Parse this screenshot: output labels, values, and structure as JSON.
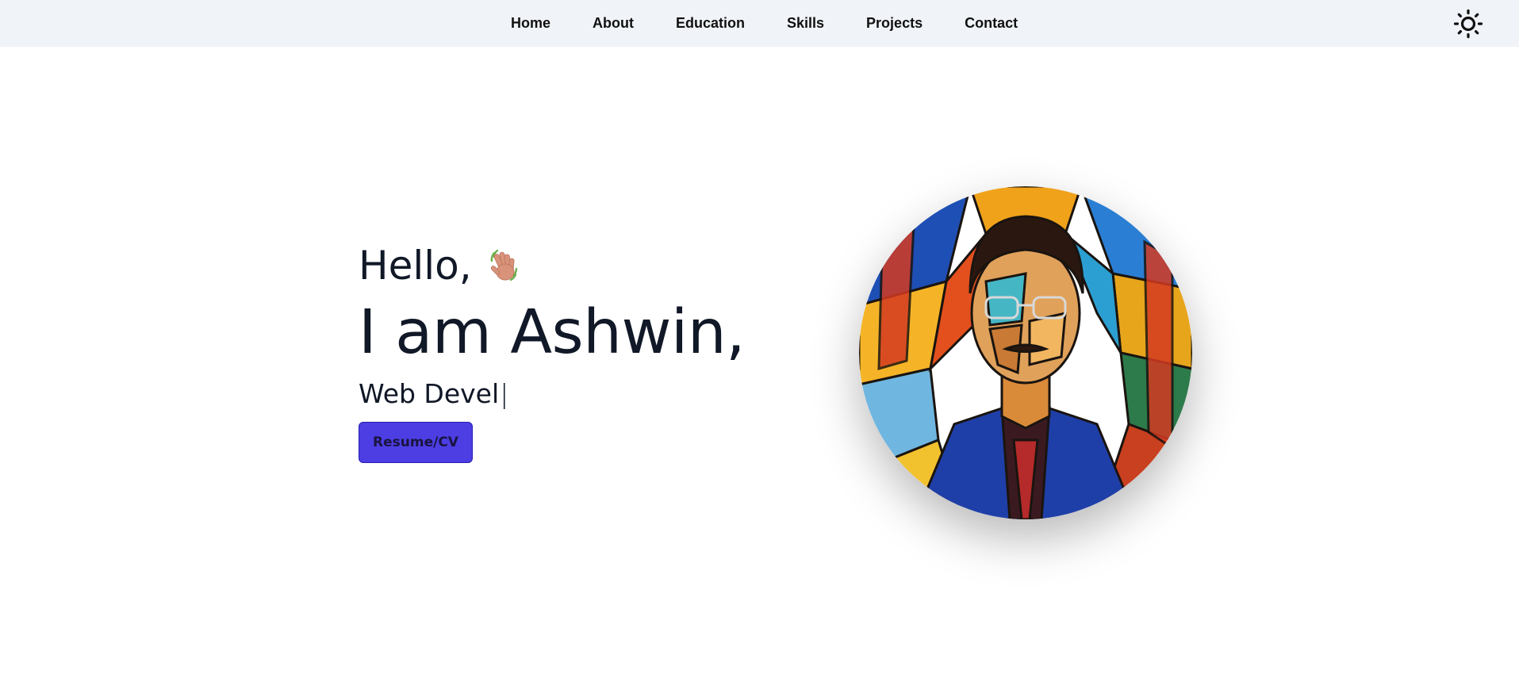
{
  "nav": {
    "links": [
      "Home",
      "About",
      "Education",
      "Skills",
      "Projects",
      "Contact"
    ],
    "theme_toggle_icon": "sun-icon"
  },
  "hero": {
    "greeting": "Hello,",
    "greeting_icon": "waving-hand-icon",
    "name_heading": "I am Ashwin,",
    "role_typed": "Web Devel",
    "caret": "|",
    "resume_button_label": "Resume/CV",
    "avatar_icon": "stained-glass-portrait-avatar"
  },
  "colors": {
    "nav_background": "#f0f3f8",
    "text": "#111827",
    "button_background": "#4c3ee3"
  }
}
